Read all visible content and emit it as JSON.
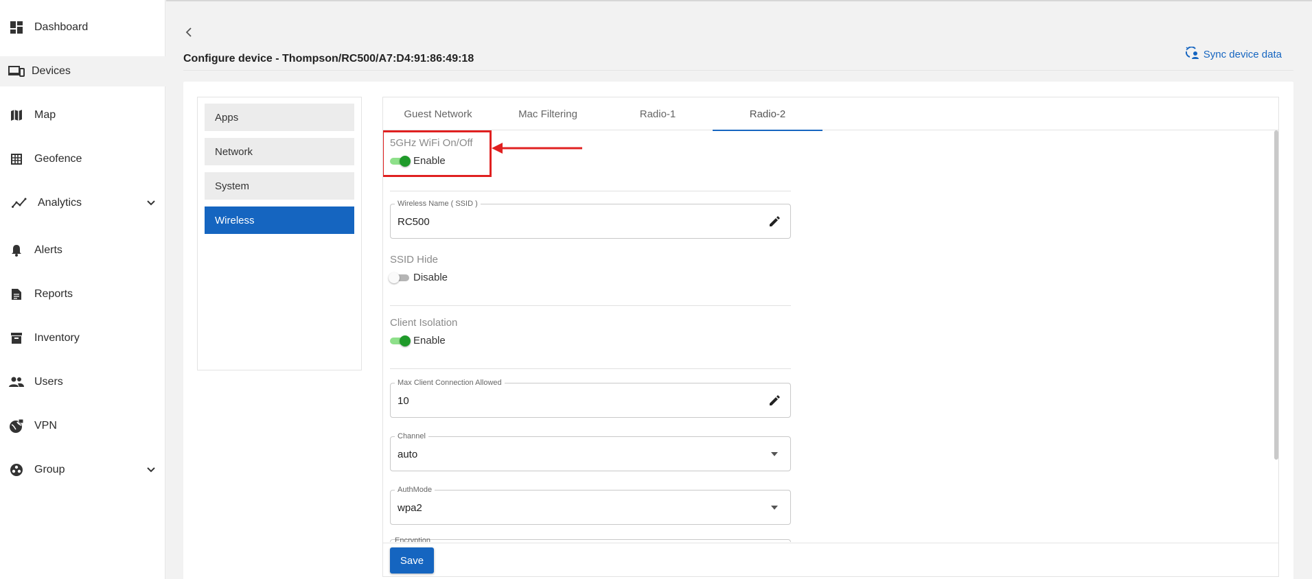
{
  "sidebar": {
    "items": [
      {
        "label": "Dashboard",
        "icon": "dashboard-icon"
      },
      {
        "label": "Devices",
        "icon": "devices-icon"
      },
      {
        "label": "Map",
        "icon": "map-icon"
      },
      {
        "label": "Geofence",
        "icon": "geofence-icon"
      },
      {
        "label": "Analytics",
        "icon": "analytics-icon"
      },
      {
        "label": "Alerts",
        "icon": "bell-icon"
      },
      {
        "label": "Reports",
        "icon": "reports-icon"
      },
      {
        "label": "Inventory",
        "icon": "archive-icon"
      },
      {
        "label": "Users",
        "icon": "users-icon"
      },
      {
        "label": "VPN",
        "icon": "vpn-icon"
      },
      {
        "label": "Group",
        "icon": "group-icon"
      }
    ],
    "active": "Devices"
  },
  "header": {
    "title": "Configure device - Thompson/RC500/A7:D4:91:86:49:18",
    "sync_label": "Sync device data"
  },
  "left_panel": {
    "items": [
      "Apps",
      "Network",
      "System",
      "Wireless"
    ],
    "active": "Wireless"
  },
  "tabs": {
    "items": [
      "Guest Network",
      "Mac Filtering",
      "Radio-1",
      "Radio-2"
    ],
    "active": "Radio-2"
  },
  "form": {
    "wifi": {
      "label": "5GHz WiFi On/Off",
      "state": "Enable"
    },
    "ssid": {
      "label": "Wireless Name ( SSID )",
      "value": "RC500"
    },
    "ssid_hide": {
      "label": "SSID Hide",
      "state": "Disable"
    },
    "client_isolation": {
      "label": "Client Isolation",
      "state": "Enable"
    },
    "max_clients": {
      "label": "Max Client Connection Allowed",
      "value": "10"
    },
    "channel": {
      "label": "Channel",
      "value": "auto"
    },
    "authmode": {
      "label": "AuthMode",
      "value": "wpa2"
    },
    "encryption": {
      "label": "Encryption"
    },
    "save_label": "Save"
  },
  "colors": {
    "accent": "#1565c0",
    "toggle_on": "#1f9a2a",
    "annotation": "#e02020"
  }
}
